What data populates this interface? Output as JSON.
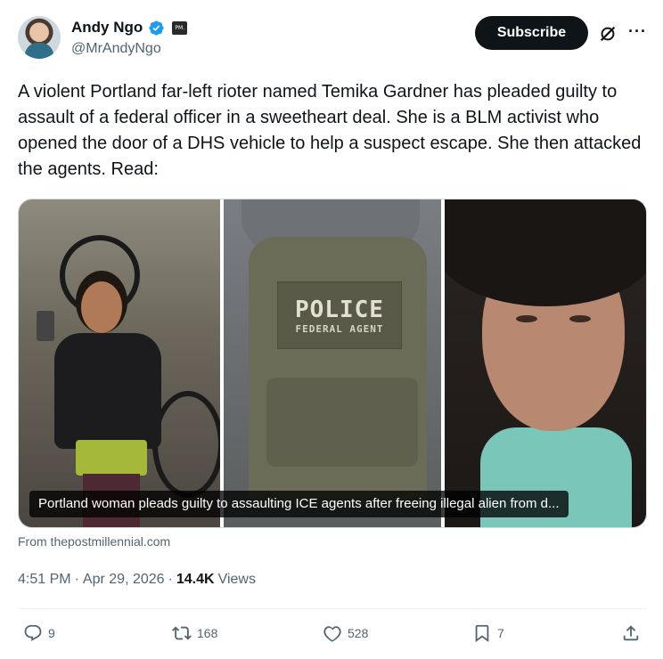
{
  "author": {
    "name": "Andy Ngo",
    "handle": "@MrAndyNgo",
    "verified_icon": "verified-badge-icon",
    "affiliation_badge": "PM."
  },
  "header": {
    "subscribe_label": "Subscribe",
    "grok_icon": "grok-icon",
    "more_icon": "more-options-icon",
    "more_label": "···"
  },
  "tweet": {
    "text": "A violent Portland far-left rioter named Temika Gardner has pleaded guilty to assault of a federal officer in a sweetheart deal. She is a BLM activist who opened the door of a DHS vehicle to help a suspect escape. She then attacked the agents. Read:"
  },
  "card": {
    "photo_2_text_line1": "POLICE",
    "photo_2_text_line2": "FEDERAL AGENT",
    "caption": "Portland woman pleads guilty to assaulting ICE agents after freeing illegal alien from d...",
    "source": "From thepostmillennial.com"
  },
  "meta": {
    "time": "4:51 PM",
    "date": "Apr 29, 2026",
    "sep": "·",
    "views_count": "14.4K",
    "views_label": "Views"
  },
  "actions": {
    "replies": "9",
    "reposts": "168",
    "likes": "528",
    "bookmarks": "7",
    "reply_icon": "reply-icon",
    "repost_icon": "repost-icon",
    "like_icon": "heart-icon",
    "bookmark_icon": "bookmark-icon",
    "share_icon": "share-icon"
  },
  "colors": {
    "text": "#0f1419",
    "secondary": "#536471",
    "verified": "#1d9bf0",
    "button_bg": "#0f1419"
  }
}
